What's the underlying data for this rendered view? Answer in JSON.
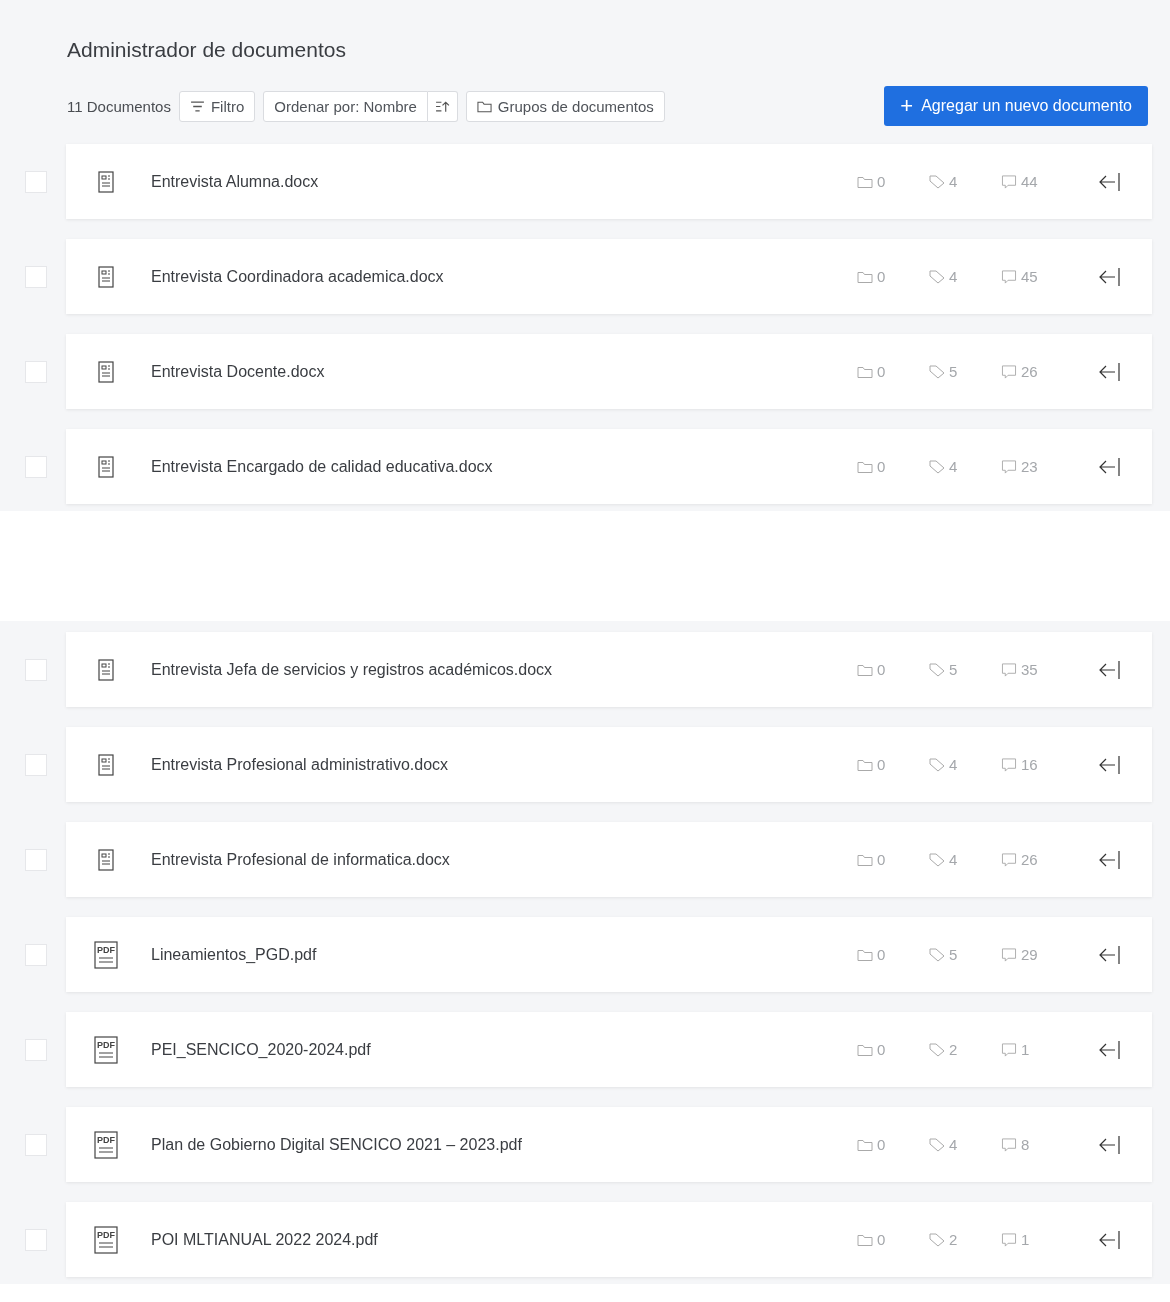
{
  "header": {
    "title": "Administrador de documentos",
    "count": "11 Documentos",
    "filter_button": "Filtro",
    "sort_button": "Ordenar por: Nombre",
    "groups_button": "Grupos de documentos",
    "add_button": {
      "icon": "+",
      "label": "Agregar un nuevo documento"
    }
  },
  "sections": [
    {
      "documents": [
        {
          "kind": "docx",
          "name": "Entrevista Alumna.docx",
          "checked": false,
          "groups": "0",
          "codes": "4",
          "comments": "44"
        },
        {
          "kind": "docx",
          "name": "Entrevista Coordinadora academica.docx",
          "checked": false,
          "groups": "0",
          "codes": "4",
          "comments": "45"
        },
        {
          "kind": "docx",
          "name": "Entrevista Docente.docx",
          "checked": false,
          "groups": "0",
          "codes": "5",
          "comments": "26"
        },
        {
          "kind": "docx",
          "name": "Entrevista Encargado de calidad educativa.docx",
          "checked": false,
          "groups": "0",
          "codes": "4",
          "comments": "23"
        }
      ]
    },
    {
      "documents": [
        {
          "kind": "docx",
          "name": "Entrevista Jefa de servicios y registros académicos.docx",
          "checked": false,
          "groups": "0",
          "codes": "5",
          "comments": "35"
        },
        {
          "kind": "docx",
          "name": "Entrevista Profesional administrativo.docx",
          "checked": false,
          "groups": "0",
          "codes": "4",
          "comments": "16"
        },
        {
          "kind": "docx",
          "name": "Entrevista Profesional de informatica.docx",
          "checked": false,
          "groups": "0",
          "codes": "4",
          "comments": "26"
        },
        {
          "kind": "pdf",
          "icon_label": "PDF",
          "name": "Lineamientos_PGD.pdf",
          "checked": false,
          "groups": "0",
          "codes": "5",
          "comments": "29"
        },
        {
          "kind": "pdf",
          "icon_label": "PDF",
          "name": "PEI_SENCICO_2020-2024.pdf",
          "checked": false,
          "groups": "0",
          "codes": "2",
          "comments": "1"
        },
        {
          "kind": "pdf",
          "icon_label": "PDF",
          "name": "Plan de Gobierno Digital SENCICO 2021 – 2023.pdf",
          "checked": false,
          "groups": "0",
          "codes": "4",
          "comments": "8"
        },
        {
          "kind": "pdf",
          "icon_label": "PDF",
          "name": "POI MLTIANUAL 2022 2024.pdf",
          "checked": false,
          "groups": "0",
          "codes": "2",
          "comments": "1"
        }
      ]
    }
  ]
}
